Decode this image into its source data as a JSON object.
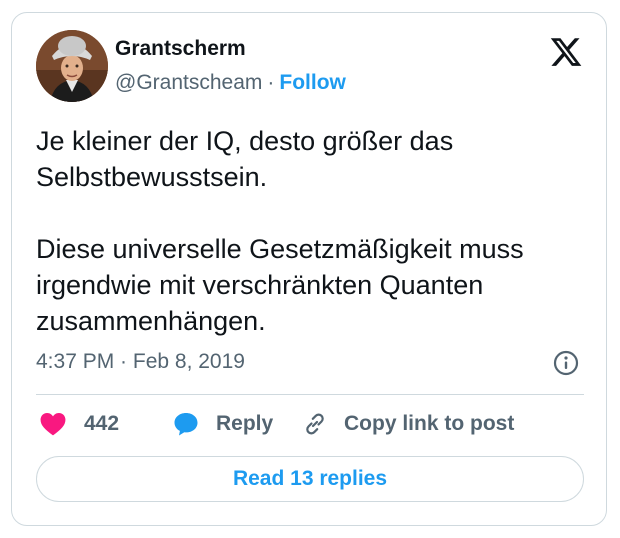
{
  "author": {
    "name": "Grantscherm",
    "handle": "@Grantscheam",
    "separator": "·",
    "follow_label": "Follow",
    "avatar_icon": "avatar-portrait"
  },
  "brand": {
    "icon": "x-logo-icon"
  },
  "tweet": {
    "lines": [
      "Je kleiner der IQ, desto größer das",
      "Selbstbewusstsein.",
      "Diese universelle Gesetzmäßigkeit muss",
      "irgendwie mit verschränkten Quanten",
      "zusammenhängen."
    ],
    "timestamp": "4:37 PM · Feb 8, 2019"
  },
  "actions": {
    "like_count": "442",
    "reply_label": "Reply",
    "copy_label": "Copy link to post"
  },
  "footer": {
    "read_replies_label": "Read 13 replies"
  },
  "colors": {
    "accent": "#1d9bf0",
    "like": "#f91880",
    "text": "#0f1419",
    "muted": "#536471",
    "border": "#cfd9de"
  }
}
